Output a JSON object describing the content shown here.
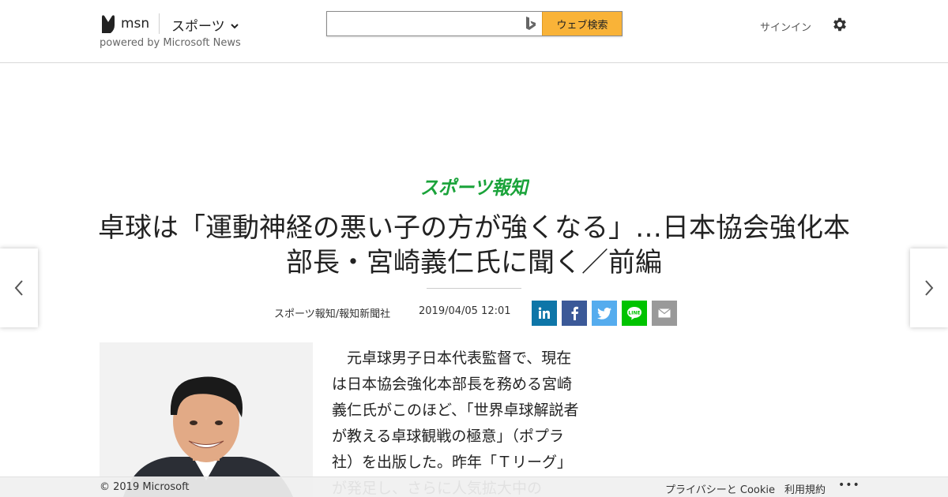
{
  "header": {
    "logo_text": "msn",
    "section": "スポーツ",
    "powered_by": "powered by Microsoft News",
    "search_value": "",
    "search_button": "ウェブ検索",
    "signin": "サインイン"
  },
  "article": {
    "source_logo": "スポーツ報知",
    "title": "卓球は「運動神経の悪い子の方が強くなる」…日本協会強化本部長・宮崎義仁氏に聞く／前編",
    "byline": "スポーツ報知/報知新聞社",
    "date": "2019/04/05 12:01",
    "share": [
      "linkedin-icon",
      "facebook-icon",
      "twitter-icon",
      "line-icon",
      "mail-icon"
    ],
    "body": "元卓球男子日本代表監督で、現在は日本協会強化本部長を務める宮崎義仁氏がこのほど、「世界卓球解説者が教える卓球観戦の極意」（ポプラ社）を出版した。昨年「Ｔリーグ」が発足し、さらに人気拡大中の"
  },
  "footer": {
    "copyright": "© 2019 Microsoft",
    "privacy": "プライバシーと Cookie",
    "terms": "利用規約",
    "more": "•••"
  },
  "colors": {
    "search_button": "#f9b338",
    "source_logo": "#1aa33a",
    "linkedin": "#0e76a8",
    "facebook": "#3b5998",
    "twitter": "#55acee",
    "line": "#00c300",
    "mail": "#999999"
  }
}
